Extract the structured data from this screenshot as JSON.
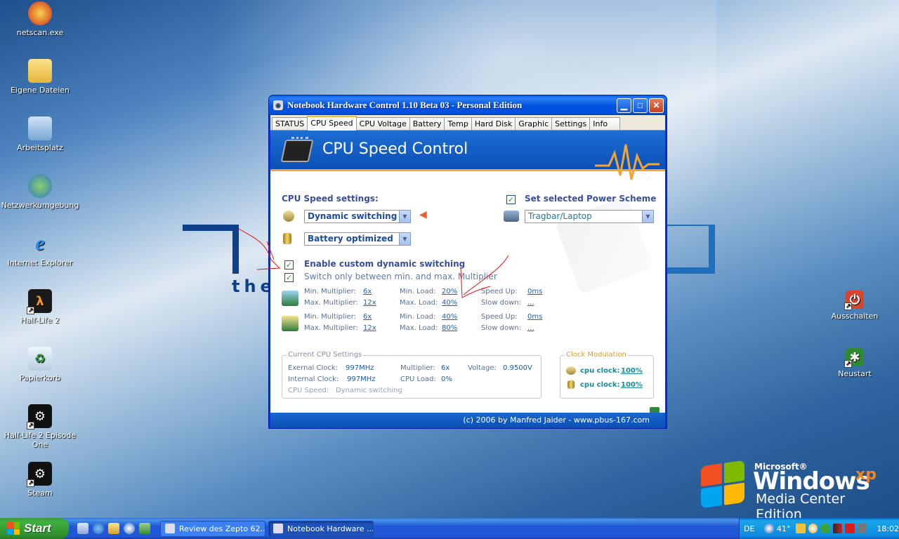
{
  "desktop": {
    "icons": [
      {
        "label": "netscan.exe"
      },
      {
        "label": "Eigene Dateien"
      },
      {
        "label": "Arbeitsplatz"
      },
      {
        "label": "Netzwerkumgebung"
      },
      {
        "label": "Internet Explorer"
      },
      {
        "label": "Half-Life 2"
      },
      {
        "label": "Papierkorb"
      },
      {
        "label": "Half-Life 2 Episode One"
      },
      {
        "label": "Steam"
      },
      {
        "label": "Ausschalten"
      },
      {
        "label": "Neustart"
      }
    ],
    "branding": {
      "ms": "Microsoft®",
      "windows": "Windows",
      "xp": "xp",
      "edition": "Media Center Edition",
      "wallpaper_text": "the"
    }
  },
  "window": {
    "title": "Notebook Hardware Control 1.10 Beta 03  -  Personal Edition",
    "tabs": [
      "STATUS",
      "CPU Speed",
      "CPU Voltage",
      "Battery",
      "Temp",
      "Hard Disk",
      "Graphic",
      "Settings",
      "Info"
    ],
    "banner_title": "CPU Speed Control",
    "speed_settings_label": "CPU Speed settings:",
    "mode_select": "Dynamic switching",
    "profile_select": "Battery optimized",
    "power_scheme_label": "Set selected Power Scheme",
    "power_scheme_select": "Tragbar/Laptop",
    "enable_custom": "Enable custom dynamic switching",
    "switch_only": "Switch only between min. and max. Multiplier",
    "battery_profile": {
      "min_mult_label": "Min. Multiplier:",
      "min_mult": "6x",
      "max_mult_label": "Max. Multiplier:",
      "max_mult": "12x",
      "min_load_label": "Min. Load:",
      "min_load": "20%",
      "max_load_label": "Max. Load:",
      "max_load": "40%",
      "speed_up_label": "Speed Up:",
      "speed_up": "0ms",
      "slow_down_label": "Slow down:",
      "slow_down": "..."
    },
    "ac_profile": {
      "min_mult_label": "Min. Multiplier:",
      "min_mult": "6x",
      "max_mult_label": "Max. Multiplier:",
      "max_mult": "12x",
      "min_load_label": "Min. Load:",
      "min_load": "40%",
      "max_load_label": "Max. Load:",
      "max_load": "80%",
      "speed_up_label": "Speed Up:",
      "speed_up": "0ms",
      "slow_down_label": "Slow down:",
      "slow_down": "..."
    },
    "current": {
      "legend": "Current CPU Settings",
      "ext_clock_label": "Exernal Clock:",
      "ext_clock": "997MHz",
      "int_clock_label": "Internal Clock:",
      "int_clock": "997MHz",
      "multiplier_label": "Multiplier:",
      "multiplier": "6x",
      "cpu_load_label": "CPU Load:",
      "cpu_load": "0%",
      "voltage_label": "Voltage:",
      "voltage": "0.9500V",
      "cpu_speed_label": "CPU Speed:",
      "cpu_speed": "Dynamic switching"
    },
    "clock_mod": {
      "legend": "Clock Modulation",
      "row1_label": "cpu clock:",
      "row1_value": "100%",
      "row2_label": "cpu clock:",
      "row2_value": "100%"
    },
    "footer": "(c) 2006 by Manfred Jaider  -  www.pbus-167.com"
  },
  "taskbar": {
    "start": "Start",
    "tasks": [
      "Review des Zepto 62...",
      "Notebook Hardware ..."
    ],
    "lang": "DE",
    "temp": "41°",
    "clock": "18:02"
  },
  "colors": {
    "accent": "#0053e1",
    "banner": "#1d6ed4",
    "orange": "#f2a531",
    "link": "#2060c0"
  }
}
